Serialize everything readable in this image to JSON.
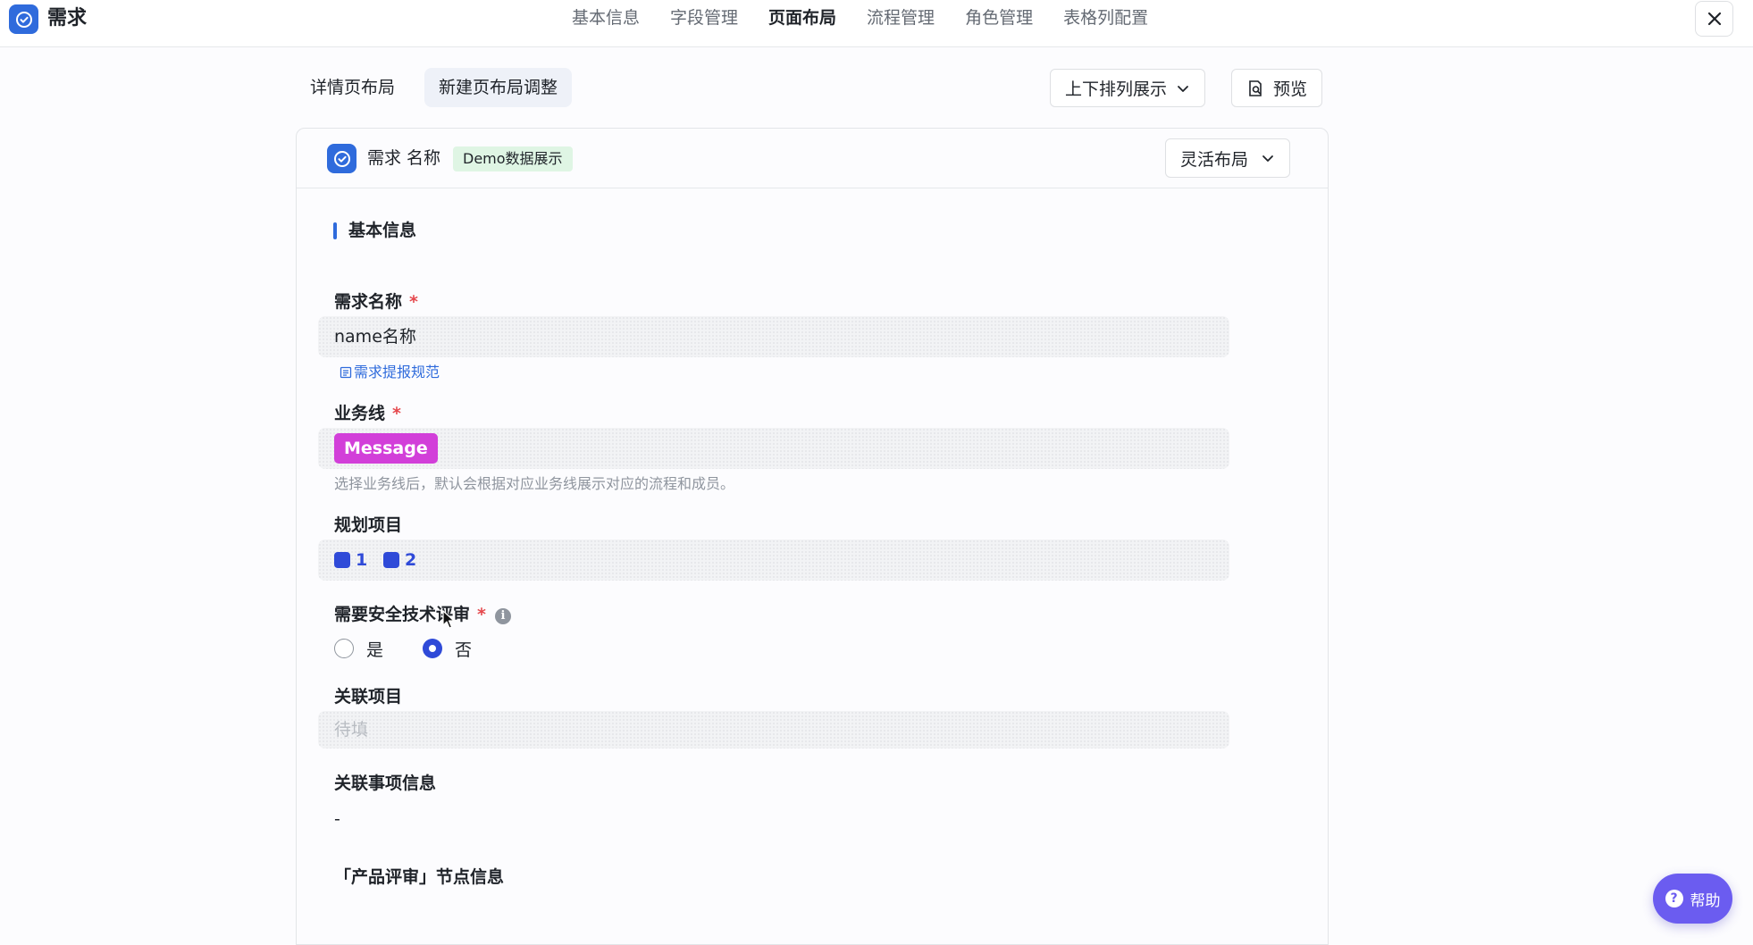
{
  "app": {
    "title": "需求"
  },
  "top_tabs": [
    {
      "label": "基本信息"
    },
    {
      "label": "字段管理"
    },
    {
      "label": "页面布局",
      "active": true
    },
    {
      "label": "流程管理"
    },
    {
      "label": "角色管理"
    },
    {
      "label": "表格列配置"
    }
  ],
  "sub_tabs": [
    {
      "label": "详情页布局"
    },
    {
      "label": "新建页布局调整",
      "active": true
    }
  ],
  "toolbar": {
    "arrange_select": "上下排列展示",
    "preview_label": "预览"
  },
  "card": {
    "title": "需求 名称",
    "badge": "Demo数据展示",
    "layout_select": "灵活布局"
  },
  "section": {
    "title": "基本信息"
  },
  "fields": {
    "name": {
      "label": "需求名称",
      "required_mark": "*",
      "value": "name名称",
      "link": "需求提报规范"
    },
    "business_line": {
      "label": "业务线",
      "required_mark": "*",
      "tag": "Message",
      "hint": "选择业务线后，默认会根据对应业务线展示对应的流程和成员。"
    },
    "plan_project": {
      "label": "规划项目",
      "items": [
        "1",
        "2"
      ]
    },
    "security_review": {
      "label": "需要安全技术评审",
      "required_mark": "*",
      "options": [
        "是",
        "否"
      ],
      "selected": "否"
    },
    "related_project": {
      "label": "关联项目",
      "placeholder": "待填"
    },
    "related_info": {
      "label": "关联事项信息",
      "value": "-"
    },
    "product_review": {
      "label": "「产品评审」节点信息"
    }
  },
  "help": {
    "label": "帮助"
  },
  "colors": {
    "accent": "#2f6bdc",
    "tag_message": "#d23fd9",
    "badge_bg": "#dff5e4",
    "help_bg": "#6b5cf0",
    "required": "#e5484d"
  }
}
